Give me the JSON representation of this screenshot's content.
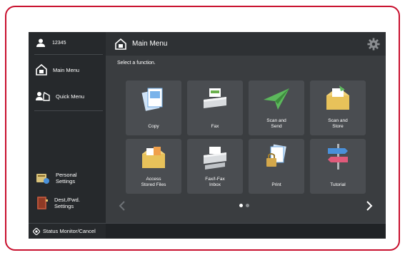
{
  "sidebar": {
    "user_id": "12345",
    "items": [
      {
        "label": "Main Menu",
        "icon": "home-icon"
      },
      {
        "label": "Quick Menu",
        "icon": "quick-menu-icon"
      },
      {
        "label": "Personal\nSettings",
        "icon": "personal-settings-icon"
      },
      {
        "label": "Dest./Fwd.\nSettings",
        "icon": "address-book-icon"
      }
    ],
    "status_monitor": "Status Monitor/Cancel"
  },
  "header": {
    "title": "Main Menu",
    "icon": "home-icon",
    "settings_icon": "gear-icon"
  },
  "instruction": "Select a function.",
  "functions": [
    {
      "label": "Copy",
      "icon": "copy-icon"
    },
    {
      "label": "Fax",
      "icon": "fax-icon"
    },
    {
      "label": "Scan and\nSend",
      "icon": "scan-send-icon"
    },
    {
      "label": "Scan and\nStore",
      "icon": "scan-store-icon"
    },
    {
      "label": "Access\nStored Files",
      "icon": "stored-files-icon"
    },
    {
      "label": "Fax/I-Fax\nInbox",
      "icon": "fax-inbox-icon"
    },
    {
      "label": "Print",
      "icon": "print-icon"
    },
    {
      "label": "Tutorial",
      "icon": "tutorial-icon"
    }
  ],
  "pagination": {
    "current_page": 1,
    "total_pages": 2
  },
  "colors": {
    "frame": "#c8102e",
    "screen_bg": "#3a3d40",
    "sidebar_bg": "#26292c",
    "tile_bg": "#4a4d51"
  }
}
